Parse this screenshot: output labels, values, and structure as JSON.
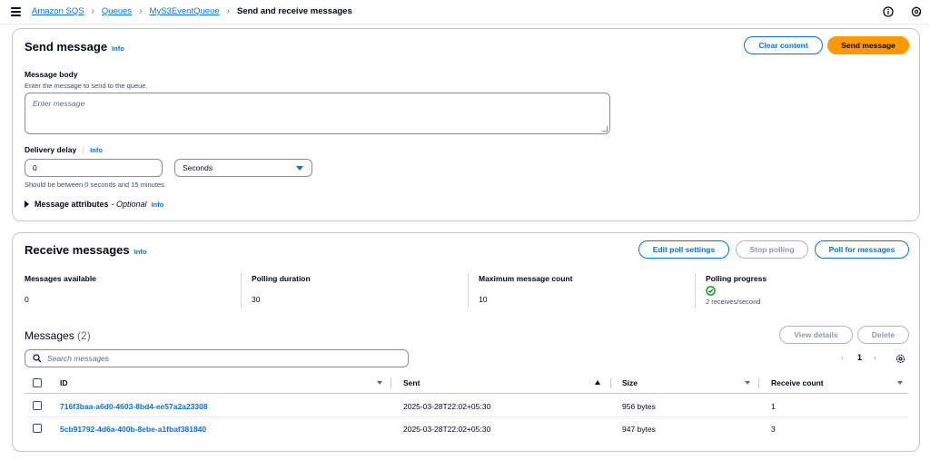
{
  "breadcrumb": {
    "items": [
      "Amazon SQS",
      "Queues",
      "MyS3EventQueue"
    ],
    "current": "Send and receive messages"
  },
  "send": {
    "title": "Send message",
    "info": "Info",
    "clear_label": "Clear content",
    "send_label": "Send message",
    "body_label": "Message body",
    "body_desc": "Enter the message to send to the queue.",
    "body_placeholder": "Enter message",
    "delay_label": "Delivery delay",
    "delay_info": "Info",
    "delay_value": "0",
    "delay_unit": "Seconds",
    "delay_hint": "Should be between 0 seconds and 15 minutes.",
    "attributes_label": "Message attributes",
    "attributes_optional": "- Optional",
    "attributes_info": "Info"
  },
  "receive": {
    "title": "Receive messages",
    "info": "Info",
    "edit_poll_label": "Edit poll settings",
    "stop_polling_label": "Stop polling",
    "poll_label": "Poll for messages",
    "stats": [
      {
        "label": "Messages available",
        "value": "0"
      },
      {
        "label": "Polling duration",
        "value": "30"
      },
      {
        "label": "Maximum message count",
        "value": "10"
      }
    ],
    "polling_progress": {
      "label": "Polling progress",
      "value": "2 receives/second"
    },
    "messages_title": "Messages",
    "messages_count": "(2)",
    "view_details_label": "View details",
    "delete_label": "Delete",
    "search_placeholder": "Search messages",
    "page": "1",
    "columns": [
      "ID",
      "Sent",
      "Size",
      "Receive count"
    ],
    "rows": [
      {
        "id": "716f3baa-a6d0-4603-8bd4-ee57a2a23308",
        "sent": "2025-03-28T22:02+05:30",
        "size": "956 bytes",
        "count": "1"
      },
      {
        "id": "5cb91792-4d6a-400b-8ebe-a1fbaf381840",
        "sent": "2025-03-28T22:02+05:30",
        "size": "947 bytes",
        "count": "3"
      }
    ]
  },
  "colors": {
    "accent": "#0972d3",
    "primary_button": "#ff9900",
    "success": "#037f0c"
  }
}
